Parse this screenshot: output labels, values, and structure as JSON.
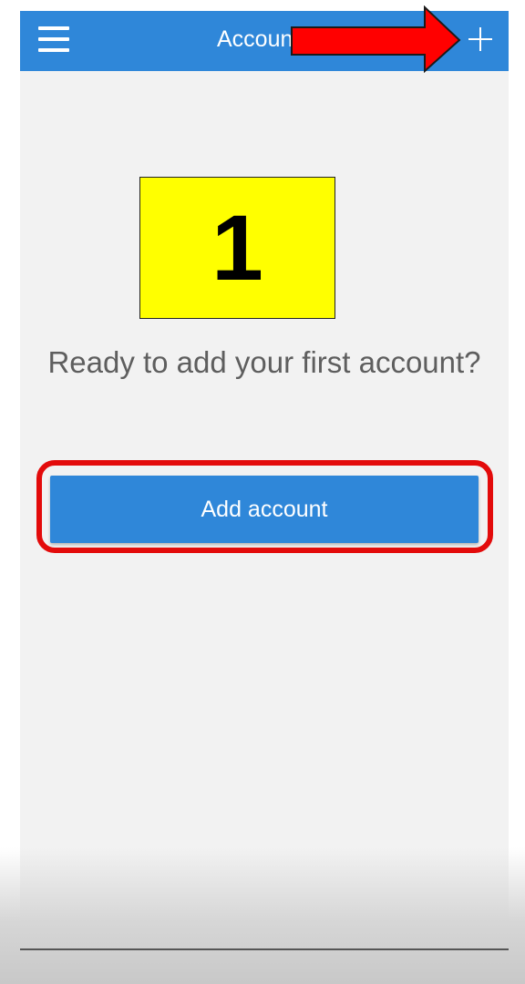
{
  "appbar": {
    "title": "Accoun",
    "menu_icon": "hamburger-menu-icon",
    "add_icon": "plus-icon",
    "color": "#2f87d9"
  },
  "annotation": {
    "step_number": "1",
    "box_color": "#ffff00",
    "arrow_color": "#ff0000",
    "highlight_color": "#e30b0b"
  },
  "main": {
    "prompt_text": "Ready to add your first account?",
    "add_account_label": "Add account",
    "background": "#f2f2f2"
  }
}
